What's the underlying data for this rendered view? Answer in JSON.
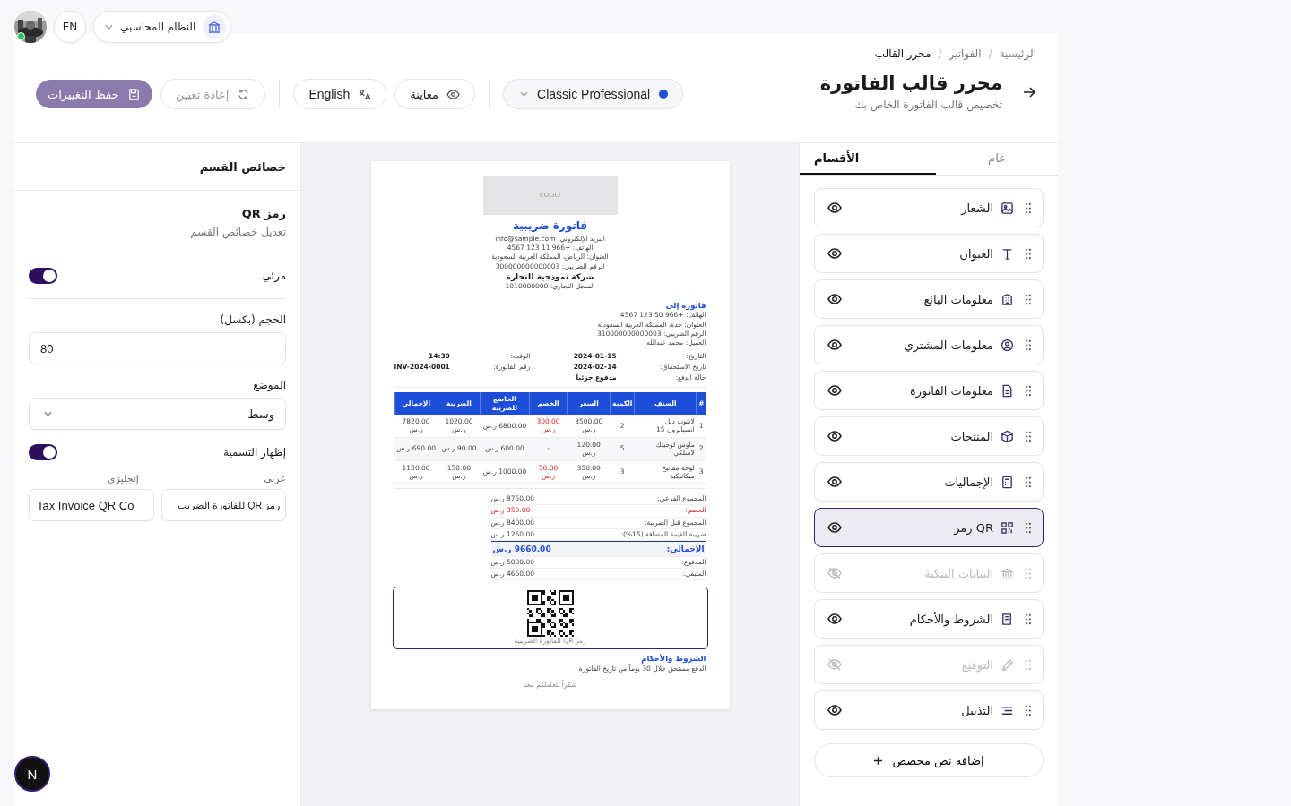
{
  "top_bar": {
    "language": "EN",
    "system_selector": "النظام المحاسبي"
  },
  "breadcrumb": [
    {
      "label": "الرئيسية",
      "current": false,
      "separator": "/"
    },
    {
      "label": "الفواتير",
      "current": false,
      "separator": "/"
    },
    {
      "label": "محرر القالب",
      "current": true
    }
  ],
  "page": {
    "title": "محرر قالب الفاتورة",
    "subtitle": "تخصيص قالب الفاتورة الخاص بك"
  },
  "toolbar": {
    "save": {
      "label": "حفظ التغييرات",
      "disabled": true
    },
    "reset": {
      "label": "إعادة تعيين",
      "disabled": true
    },
    "language": "English",
    "preview": "معاينة",
    "template": {
      "name": "Classic Professional",
      "color": "#1d4ed8"
    }
  },
  "properties": {
    "header": "خصائص القسم",
    "title": "رمز QR",
    "subtitle": "تعديل خصائص القسم",
    "visible": {
      "label": "مرئي",
      "on": true
    },
    "size": {
      "label": "الحجم (بكسل)",
      "value": "80"
    },
    "position": {
      "label": "الموضع",
      "value": "وسط"
    },
    "show_label": {
      "label": "إظهار التسمية",
      "on": true
    },
    "label_ar": {
      "label": "عربي",
      "value": "رمز QR للفاتورة الضريب"
    },
    "label_en": {
      "label": "إنجليزي",
      "value": "Tax Invoice QR Co"
    }
  },
  "invoice": {
    "logo": "LOGO",
    "title": "فاتورة ضريبية",
    "seller_lines": [
      "البريد الإلكتروني: info@sample.com",
      "الهاتف: +966 11 123 4567",
      "العنوان: الرياض، المملكة العربية السعودية",
      "الرقم الضريبي: 300000000000003"
    ],
    "seller_name": "شركة نموذجية للتجارة",
    "seller_cr": "السجل التجاري: 1010000000",
    "bill_to_title": "فاتورة إلى",
    "buyer_lines": [
      "الهاتف: +966 50 123 4567",
      "العنوان: جدة، المملكة العربية السعودية",
      "الرقم الضريبي: 310000000000003",
      "العميل: محمد عبدالله"
    ],
    "meta": [
      {
        "label": "التاريخ:",
        "value": "2024-01-15"
      },
      {
        "label": "الوقت:",
        "value": "14:30"
      },
      {
        "label": "تاريخ الاستحقاق:",
        "value": "2024-02-14"
      },
      {
        "label": "رقم الفاتورة:",
        "value": "INV-2024-0001"
      },
      {
        "label": "حالة الدفع:",
        "value": "مدفوع جزئياً"
      }
    ],
    "table": {
      "columns": [
        "#",
        "الصنف",
        "الكمية",
        "السعر",
        "الخصم",
        "الخاضع للضريبة",
        "الضريبة",
        "الإجمالي"
      ],
      "rows": [
        {
          "discounted": true,
          "cells": [
            "1",
            "لابتوب ديل انسبايرون 15",
            "2",
            "3500.00 ر.س",
            "300.00 ر.س",
            "6800.00 ر.س",
            "1020.00 ر.س",
            "7820.00 ر.س"
          ]
        },
        {
          "discounted": false,
          "cells": [
            "2",
            "ماوس لوجيتك لاسلكي",
            "5",
            "120.00 ر.س",
            "-",
            "600.00 ر.س",
            "90.00 ر.س",
            "690.00 ر.س"
          ]
        },
        {
          "discounted": true,
          "cells": [
            "3",
            "لوحة مفاتيح ميكانيكية",
            "3",
            "350.00 ر.س",
            "50.00 ر.س",
            "1000.00 ر.س",
            "150.00 ر.س",
            "1150.00 ر.س"
          ]
        }
      ]
    },
    "totals": [
      {
        "kind": "normal",
        "label": "المجموع الفرعي:",
        "value": "8750.00 ر.س"
      },
      {
        "kind": "discount",
        "label": "الخصم:",
        "value": "-350.00 ر.س"
      },
      {
        "kind": "normal",
        "label": "المجموع قبل الضريبة:",
        "value": "8400.00 ر.س"
      },
      {
        "kind": "normal",
        "label": "ضريبة القيمة المضافة (15%):",
        "value": "1260.00 ر.س"
      },
      {
        "kind": "grand",
        "label": "الإجمالي:",
        "value": "9660.00 ر.س"
      },
      {
        "kind": "normal",
        "label": "المدفوع:",
        "value": "5000.00 ر.س"
      },
      {
        "kind": "normal",
        "label": "المتبقي:",
        "value": "4660.00 ر.س"
      }
    ],
    "qr": {
      "caption": "رمز QR للفاتورة الضريبية",
      "selected": true
    },
    "terms_title": "الشروط والأحكام",
    "terms_text": "الدفع مستحق خلال 30 يوماً من تاريخ الفاتورة",
    "thanks": "شكراً لتعاملكم معنا"
  },
  "sidebar": {
    "tabs": [
      {
        "label": "عام",
        "selected": false
      },
      {
        "label": "الأقسام",
        "selected": true
      }
    ],
    "sections": [
      {
        "label": "الشعار",
        "visible": true,
        "selected": false
      },
      {
        "label": "العنوان",
        "visible": true,
        "selected": false
      },
      {
        "label": "معلومات البائع",
        "visible": true,
        "selected": false
      },
      {
        "label": "معلومات المشتري",
        "visible": true,
        "selected": false
      },
      {
        "label": "معلومات الفاتورة",
        "visible": true,
        "selected": false
      },
      {
        "label": "المنتجات",
        "visible": true,
        "selected": false
      },
      {
        "label": "الإجماليات",
        "visible": true,
        "selected": false
      },
      {
        "label": "رمز QR",
        "visible": true,
        "selected": true
      },
      {
        "label": "البيانات البنكية",
        "visible": false,
        "selected": false
      },
      {
        "label": "الشروط والأحكام",
        "visible": true,
        "selected": false
      },
      {
        "label": "التوقيع",
        "visible": false,
        "selected": false
      },
      {
        "label": "التذييل",
        "visible": true,
        "selected": false
      }
    ],
    "add_button": "إضافة نص مخصص"
  },
  "dev_badge": "N"
}
